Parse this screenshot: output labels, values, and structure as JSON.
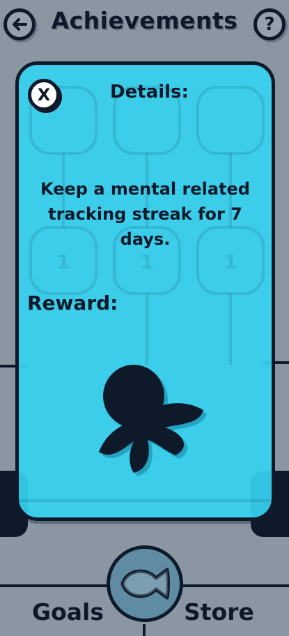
{
  "header": {
    "title": "Achievements",
    "back_icon": "back-arrow-icon",
    "help_label": "?"
  },
  "modal": {
    "close_label": "X",
    "title": "Details:",
    "description": "Keep a mental related tracking streak for 7 days.",
    "reward_label": "Reward:",
    "reward_icon": "octopus-silhouette-icon"
  },
  "achievement_nodes": {
    "level_labels": [
      "1",
      "1",
      "1"
    ]
  },
  "bottom_nav": {
    "goals_label": "Goals",
    "store_label": "Store",
    "center_icon": "fish-icon"
  },
  "colors": {
    "background": "#8a97a3",
    "modal": "#36d1f0",
    "ink": "#0e1a2a",
    "center_button": "#5f8ca3"
  }
}
